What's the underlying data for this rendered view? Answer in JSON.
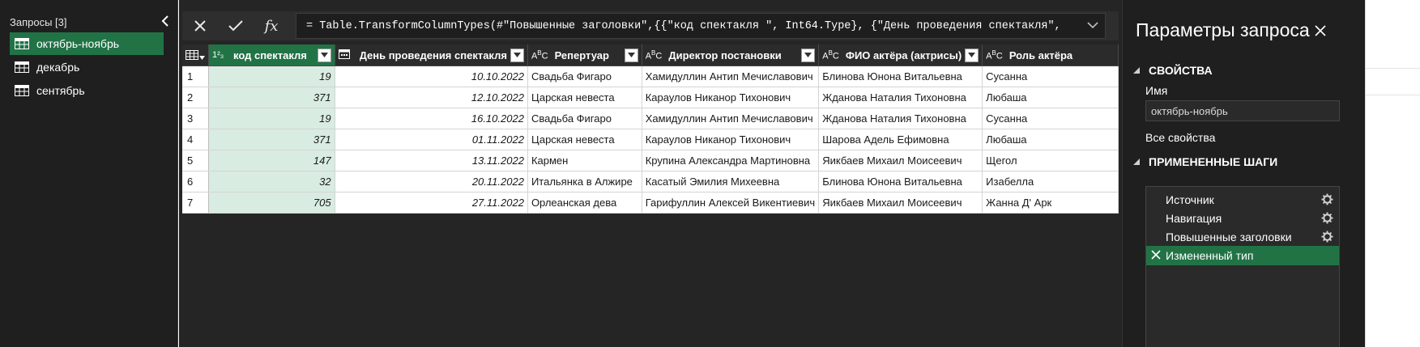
{
  "colors": {
    "accent": "#217346",
    "accent_light": "#d9ece1",
    "pane_bg": "#1f1f1f",
    "main_bg": "#252525",
    "grid_cell_bg": "#ffffff"
  },
  "queries": {
    "header": "Запросы [3]",
    "items": [
      {
        "label": "октябрь-ноябрь",
        "icon": "table-icon",
        "selected": true
      },
      {
        "label": "декабрь",
        "icon": "table-icon",
        "selected": false
      },
      {
        "label": "сентябрь",
        "icon": "table-icon",
        "selected": false
      }
    ]
  },
  "formula_bar": {
    "cancel_icon": "close-icon",
    "commit_icon": "check-icon",
    "fx_label": "fx",
    "formula": "= Table.TransformColumnTypes(#\"Повышенные заголовки\",{{\"код спектакля \", Int64.Type}, {\"День проведения спектакля\","
  },
  "grid": {
    "columns": [
      {
        "label": "код спектакля",
        "type_icon": "1²₃"
      },
      {
        "label": "День проведения спектакля",
        "type_icon": "date"
      },
      {
        "label": "Репертуар",
        "type_icon": "AᴮC"
      },
      {
        "label": "Директор постановки",
        "type_icon": "AᴮC"
      },
      {
        "label": "ФИО актёра (актрисы)",
        "type_icon": "AᴮC"
      },
      {
        "label": "Роль актёра",
        "type_icon": "AᴮC"
      }
    ],
    "rows": [
      {
        "n": "1",
        "cells": [
          "19",
          "10.10.2022",
          "Свадьба Фигаро",
          "Хамидуллин Антип Мечиславович",
          "Блинова Юнона Витальевна",
          "Сусанна"
        ]
      },
      {
        "n": "2",
        "cells": [
          "371",
          "12.10.2022",
          "Царская невеста",
          "Караулов Никанор Тихонович",
          "Жданова Наталия Тихоновна",
          "Любаша"
        ]
      },
      {
        "n": "3",
        "cells": [
          "19",
          "16.10.2022",
          "Свадьба Фигаро",
          "Хамидуллин Антип Мечиславович",
          "Жданова Наталия Тихоновна",
          "Сусанна"
        ]
      },
      {
        "n": "4",
        "cells": [
          "371",
          "01.11.2022",
          "Царская невеста",
          "Караулов Никанор Тихонович",
          "Шарова Адель Ефимовна",
          "Любаша"
        ]
      },
      {
        "n": "5",
        "cells": [
          "147",
          "13.11.2022",
          "Кармен",
          "Крупина Александра Мартиновна",
          "Яикбаев Михаил Моисеевич",
          "Щегол"
        ]
      },
      {
        "n": "6",
        "cells": [
          "32",
          "20.11.2022",
          "Итальянка в Алжире",
          "Касатый Эмилия Михеевна",
          "Блинова Юнона Витальевна",
          "Изабелла"
        ]
      },
      {
        "n": "7",
        "cells": [
          "705",
          "27.11.2022",
          "Орлеанская дева",
          "Гарифуллин Алексей Викентиевич",
          "Яикбаев Михаил Моисеевич",
          "Жанна Д' Арк"
        ]
      }
    ]
  },
  "settings": {
    "title": "Параметры запроса",
    "properties_header": "СВОЙСТВА",
    "name_label": "Имя",
    "name_value": "октябрь-ноябрь",
    "all_properties": "Все свойства",
    "steps_header": "ПРИМЕНЕННЫЕ ШАГИ",
    "steps": [
      {
        "label": "Источник",
        "gear": true,
        "active": false
      },
      {
        "label": "Навигация",
        "gear": true,
        "active": false
      },
      {
        "label": "Повышенные заголовки",
        "gear": true,
        "active": false
      },
      {
        "label": "Измененный тип",
        "gear": false,
        "active": true
      }
    ]
  }
}
